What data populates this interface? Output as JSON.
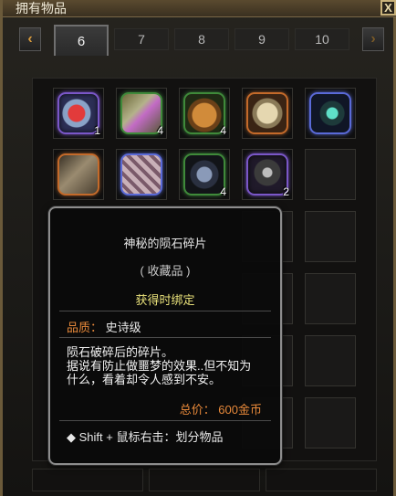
{
  "window": {
    "title": "拥有物品",
    "close_label": "X"
  },
  "tabs": {
    "prev_arrow": "‹",
    "next_arrow": "›",
    "items": [
      {
        "label": "6",
        "active": true
      },
      {
        "label": "7",
        "active": false
      },
      {
        "label": "8",
        "active": false
      },
      {
        "label": "9",
        "active": false
      },
      {
        "label": "10",
        "active": false
      }
    ]
  },
  "inventory": {
    "items": [
      {
        "icon": "meteor-fragment-icon",
        "count": "1"
      },
      {
        "icon": "scroll-book-icon",
        "count": "4"
      },
      {
        "icon": "treasure-pouch-icon",
        "count": "4"
      },
      {
        "icon": "golem-armor-icon",
        "count": ""
      },
      {
        "icon": "serpent-rune-icon",
        "count": ""
      },
      {
        "icon": "sealed-box-icon",
        "count": ""
      },
      {
        "icon": "cube-icon",
        "count": ""
      },
      {
        "icon": "dark-helmet-icon",
        "count": "4"
      },
      {
        "icon": "crow-feather-icon",
        "count": "2"
      }
    ]
  },
  "tooltip": {
    "name": "神秘的陨石碎片",
    "type": "( 收藏品 )",
    "bind": "获得时绑定",
    "quality_label": "品质：",
    "quality_value": "史诗级",
    "desc_line1": "陨石破碎后的碎片。",
    "desc_line2": "据说有防止做噩梦的效果..但不知为",
    "desc_line3": "什么，看着却令人感到不安。",
    "price": "总价：  600金币",
    "shift_hint": "◆ Shift + 鼠标右击：划分物品"
  },
  "colors": {
    "quality_epic": "#e8893a",
    "bind_text": "#e9e17a",
    "frame_gold": "#6b5a3a",
    "slot_glow": "#7a57c8"
  }
}
